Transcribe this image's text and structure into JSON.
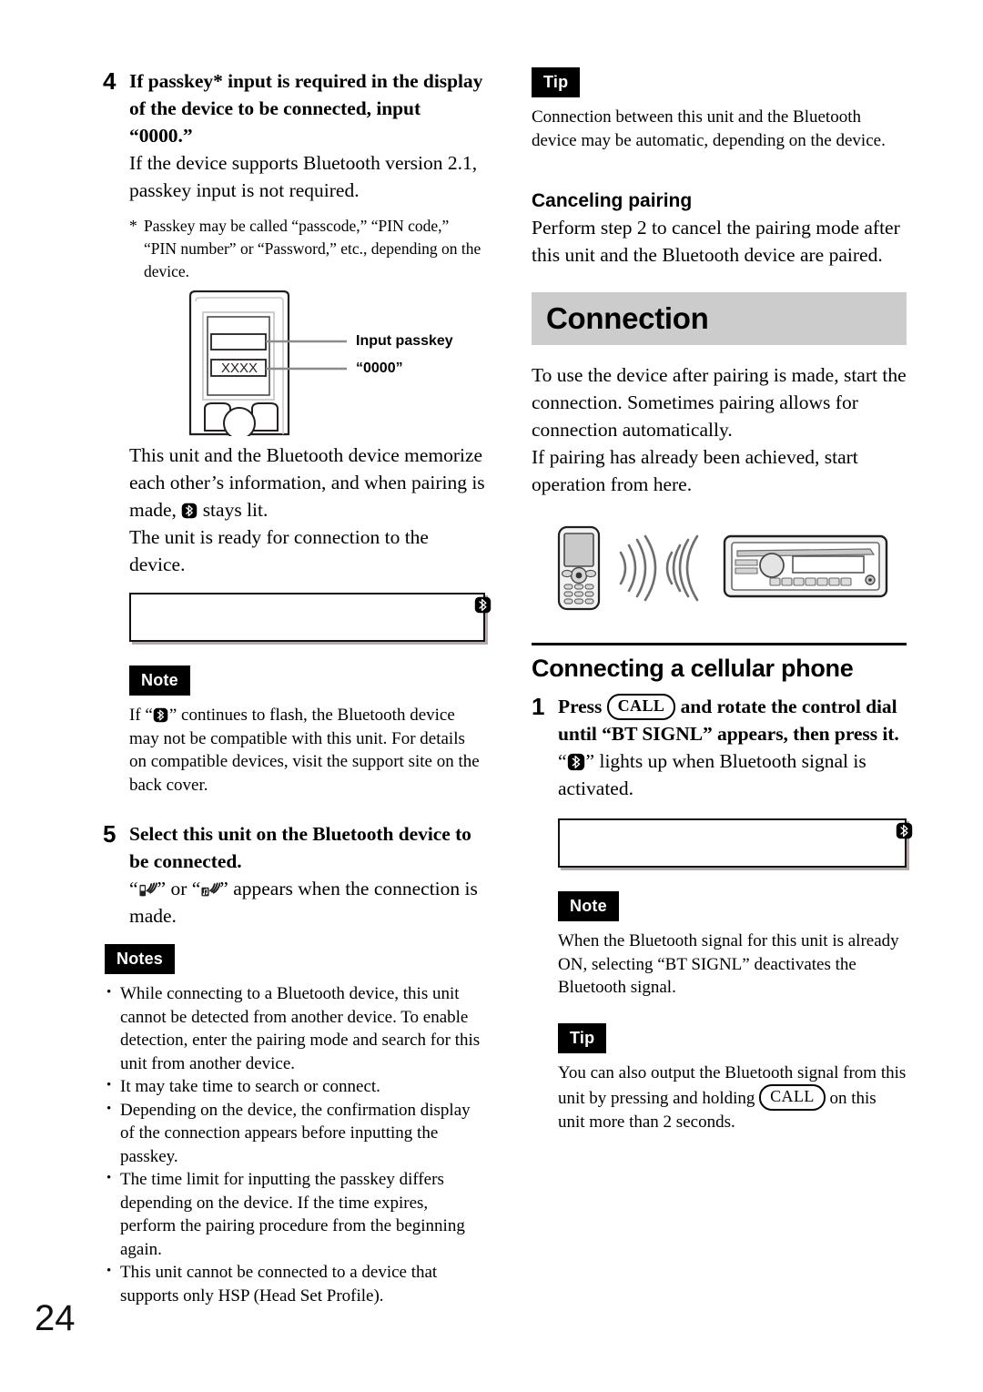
{
  "page": {
    "number": "24"
  },
  "left_column": {
    "step4": {
      "number": "4",
      "title": "If passkey* input is required in the display of the device to be connected, input “0000.”",
      "body": "If the device supports Bluetooth version 2.1, passkey input is not required.",
      "footnote_mark": "*",
      "footnote_text": "Passkey may be called “passcode,” “PIN code,” “PIN number” or “Password,” etc., depending on the device."
    },
    "figure_passkey": {
      "screen_value": "XXXX",
      "callout_1": "Input passkey",
      "callout_2": "“0000”"
    },
    "pairing_result": {
      "line1_a": "This unit and the Bluetooth device memorize each other’s information, and when pairing is made,",
      "line1_icon": "bluetooth-icon",
      "line1_b": "stays lit.",
      "line2": "The unit is ready for connection to the device."
    },
    "note": {
      "label": "Note",
      "text_a": "If “",
      "icon": "bluetooth-icon",
      "text_b": "” continues to flash, the Bluetooth device may not be compatible with this unit. For details on compatible devices, visit the support site on the back cover."
    },
    "step5": {
      "number": "5",
      "title": "Select this unit on the Bluetooth device to be connected.",
      "body_a": "“",
      "icon_1": "phone-signal-icon",
      "body_b": "” or “",
      "icon_2": "audio-signal-icon",
      "body_c": "” appears when the connection is made."
    },
    "notes": {
      "label": "Notes",
      "items": [
        "While connecting to a Bluetooth device, this unit cannot be detected from another device. To enable detection, enter the pairing mode and search for this unit from another device.",
        "It may take time to search or connect.",
        "Depending on the device, the confirmation display of the connection appears before inputting the passkey.",
        "The time limit for inputting the passkey differs depending on the device. If the time expires, perform the pairing procedure from the beginning again.",
        "This unit cannot be connected to a device that supports only HSP (Head Set Profile)."
      ]
    }
  },
  "right_column": {
    "tip_top": {
      "label": "Tip",
      "text": "Connection between this unit and the Bluetooth device may be automatic, depending on the device."
    },
    "canceling_pairing": {
      "heading": "Canceling pairing",
      "text": "Perform step 2 to cancel the pairing mode after this unit and the Bluetooth device are paired."
    },
    "connection_section": {
      "banner": "Connection",
      "para1": "To use the device after pairing is made, start the connection. Sometimes pairing allows for connection automatically.",
      "para2": "If pairing has already been achieved, start operation from here."
    },
    "figure_connect": {
      "device_left": "cellular-phone",
      "device_right": "car-stereo",
      "signal": "wireless-waves"
    },
    "connecting_cellular": {
      "heading": "Connecting a cellular phone",
      "step1": {
        "number": "1",
        "title_a": "Press",
        "button_label": "CALL",
        "title_b": "and rotate the control dial until “BT SIGNL” appears, then press it.",
        "body_a": "“",
        "body_icon": "bluetooth-icon",
        "body_b": "” lights up when Bluetooth signal is activated."
      }
    },
    "note_bottom": {
      "label": "Note",
      "text": "When the Bluetooth signal for this unit is already ON, selecting “BT SIGNL” deactivates the Bluetooth signal."
    },
    "tip_bottom": {
      "label": "Tip",
      "text_a": "You can also output the Bluetooth signal from this unit by pressing and holding",
      "button_label": "CALL",
      "text_b": "on this unit more than 2 seconds."
    }
  },
  "colors": {
    "banner_bg": "#cccccc",
    "badge_bg": "#000000",
    "text": "#000000"
  }
}
